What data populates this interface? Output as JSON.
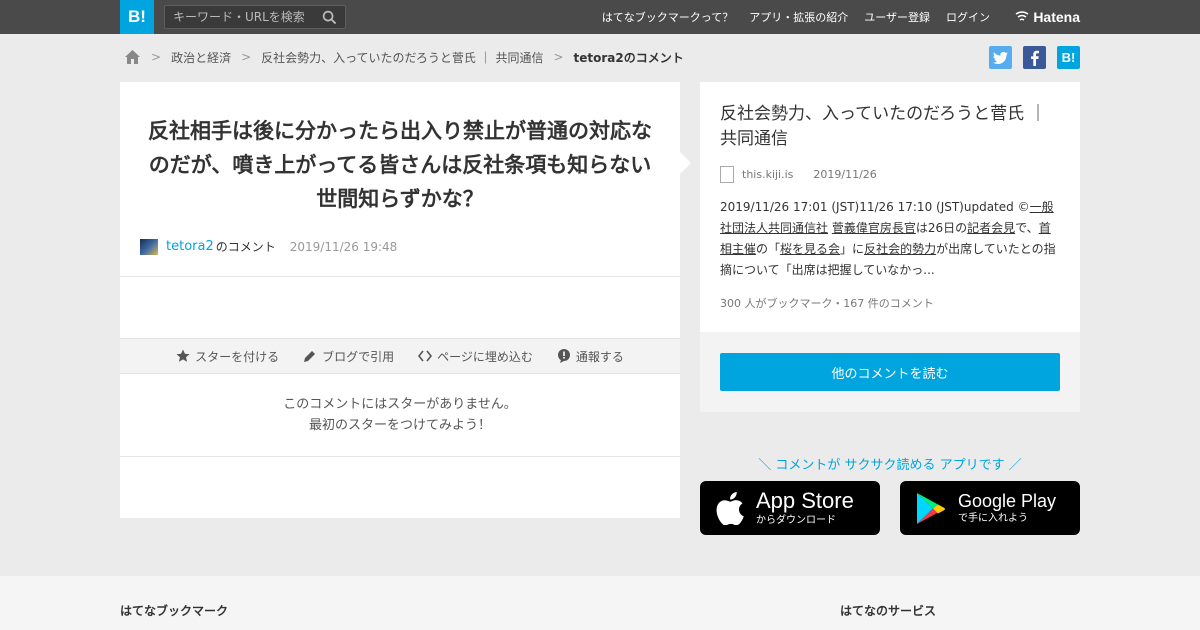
{
  "header": {
    "logo": "B!",
    "search_placeholder": "キーワード・URLを検索",
    "nav": [
      "はてなブックマークって？",
      "アプリ・拡張の紹介",
      "ユーザー登録",
      "ログイン"
    ],
    "brand": "Hatena"
  },
  "breadcrumb": {
    "items": [
      "政治と経済",
      "反社会勢力、入っていたのだろうと菅氏 ｜ 共同通信"
    ],
    "current": "tetora2のコメント"
  },
  "share": {
    "twitter": "t",
    "facebook": "f",
    "hatena": "B!"
  },
  "comment": {
    "text": "反社相手は後に分かったら出入り禁止が普通の対応なのだが、噴き上がってる皆さんは反社条項も知らない世間知らずかな？",
    "user": "tetora2",
    "user_suffix": "のコメント",
    "date": "2019/11/26 19:48",
    "actions": [
      "スターを付ける",
      "ブログで引用",
      "ページに埋め込む",
      "通報する"
    ],
    "no_star_line1": "このコメントにはスターがありません。",
    "no_star_line2": "最初のスターをつけてみよう！"
  },
  "article": {
    "title": "反社会勢力、入っていたのだろうと菅氏 ｜ 共同通信",
    "domain": "this.kiji.is",
    "date": "2019/11/26",
    "desc_parts": [
      "2019/11/26 17:01 (JST)11/26 17:10 (JST)updated ©",
      "一般社団法人共同通信社",
      " ",
      "菅義偉官房長官",
      "は26日の",
      "記者会見",
      "で、",
      "首相主催",
      "の「",
      "桜を見る会",
      "」に",
      "反社会的勢力",
      "が出席していたとの指摘について「出席は把握していなかっ..."
    ],
    "stats": "300 人がブックマーク・167 件のコメント",
    "read_more": "他のコメントを読む"
  },
  "app": {
    "tagline": "＼ コメントが サクサク読める アプリです ／",
    "apple_big": "App Store",
    "apple_small": "からダウンロード",
    "google_big": "Google Play",
    "google_small": "で手に入れよう"
  },
  "footer": {
    "left": "はてなブックマーク",
    "right": "はてなのサービス"
  },
  "colors": {
    "accent": "#00a4de",
    "topbar": "#4a4a4a"
  }
}
